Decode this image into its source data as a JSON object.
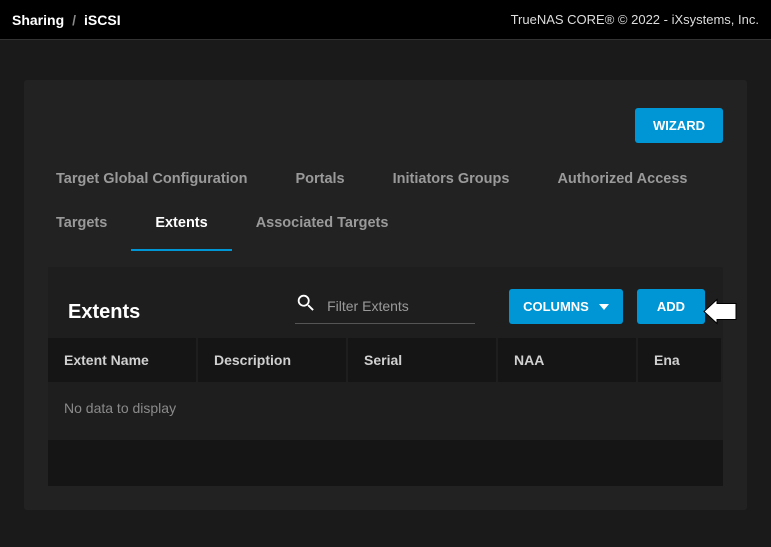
{
  "breadcrumb": {
    "root": "Sharing",
    "current": "iSCSI"
  },
  "copyright": "TrueNAS CORE® © 2022 - iXsystems, Inc.",
  "buttons": {
    "wizard": "WIZARD",
    "columns": "COLUMNS",
    "add": "ADD"
  },
  "tabs": {
    "globalConfig": "Target Global Configuration",
    "portals": "Portals",
    "initiators": "Initiators Groups",
    "authorized": "Authorized Access",
    "targets": "Targets",
    "extents": "Extents",
    "associated": "Associated Targets"
  },
  "section": {
    "title": "Extents"
  },
  "filter": {
    "placeholder": "Filter Extents"
  },
  "columns": {
    "extentName": "Extent Name",
    "description": "Description",
    "serial": "Serial",
    "naa": "NAA",
    "enabled": "Ena"
  },
  "table": {
    "empty": "No data to display"
  }
}
